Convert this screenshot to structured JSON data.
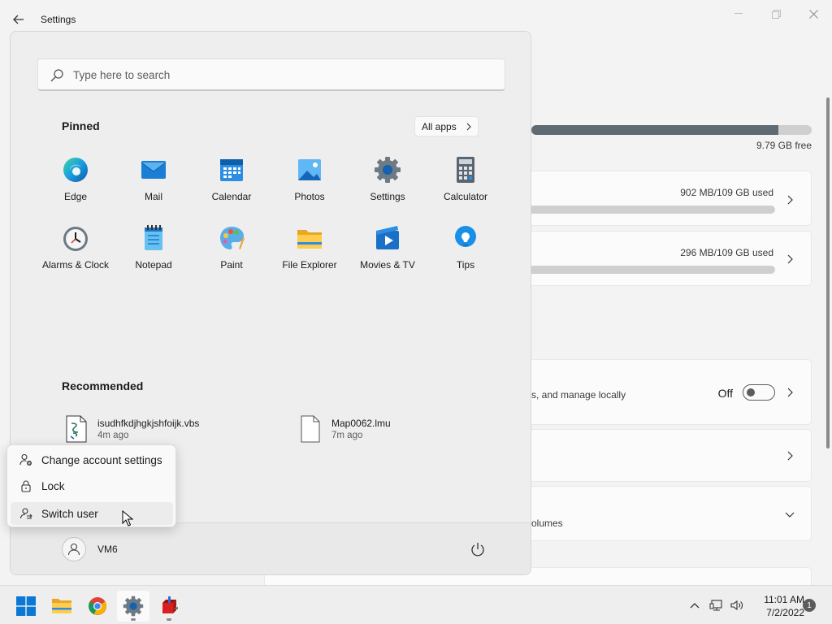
{
  "window": {
    "title": "Settings"
  },
  "storage": {
    "used_fraction": 0.88,
    "free_text": "9.79 GB free",
    "cards": [
      {
        "used_text": "902 MB/109 GB used"
      },
      {
        "used_text": "296 MB/109 GB used"
      }
    ],
    "manage_text": "s, and manage locally",
    "toggle_label": "Off",
    "volumes_text": "olumes"
  },
  "start_menu": {
    "search_placeholder": "Type here to search",
    "pinned_title": "Pinned",
    "all_apps_label": "All apps",
    "pinned": [
      {
        "label": "Edge",
        "icon": "edge-icon"
      },
      {
        "label": "Mail",
        "icon": "mail-icon"
      },
      {
        "label": "Calendar",
        "icon": "calendar-icon"
      },
      {
        "label": "Photos",
        "icon": "photos-icon"
      },
      {
        "label": "Settings",
        "icon": "settings-gear-icon"
      },
      {
        "label": "Calculator",
        "icon": "calculator-icon"
      },
      {
        "label": "Alarms & Clock",
        "icon": "clock-icon"
      },
      {
        "label": "Notepad",
        "icon": "notepad-icon"
      },
      {
        "label": "Paint",
        "icon": "paint-palette-icon"
      },
      {
        "label": "File Explorer",
        "icon": "folder-icon"
      },
      {
        "label": "Movies & TV",
        "icon": "movies-icon"
      },
      {
        "label": "Tips",
        "icon": "lightbulb-icon"
      }
    ],
    "recommended_title": "Recommended",
    "recommended": [
      {
        "name": "isudhfkdjhgkjshfoijk.vbs",
        "time": "4m ago",
        "icon": "script-file-icon"
      },
      {
        "name": "Map0062.lmu",
        "time": "7m ago",
        "icon": "blank-file-icon"
      }
    ],
    "user_name": "VM6"
  },
  "account_menu": {
    "items": [
      {
        "label": "Change account settings",
        "icon": "account-settings-icon"
      },
      {
        "label": "Lock",
        "icon": "lock-icon"
      },
      {
        "label": "Switch user",
        "icon": "switch-user-icon"
      }
    ]
  },
  "taskbar": {
    "apps": [
      "start-icon",
      "file-explorer-icon",
      "chrome-icon",
      "settings-icon",
      "rpg-maker-icon"
    ],
    "time": "11:01 AM",
    "date": "7/2/2022",
    "notification_count": "1"
  },
  "colors": {
    "accent_blue": "#0067c0",
    "storage_fill": "#5f6b74"
  }
}
